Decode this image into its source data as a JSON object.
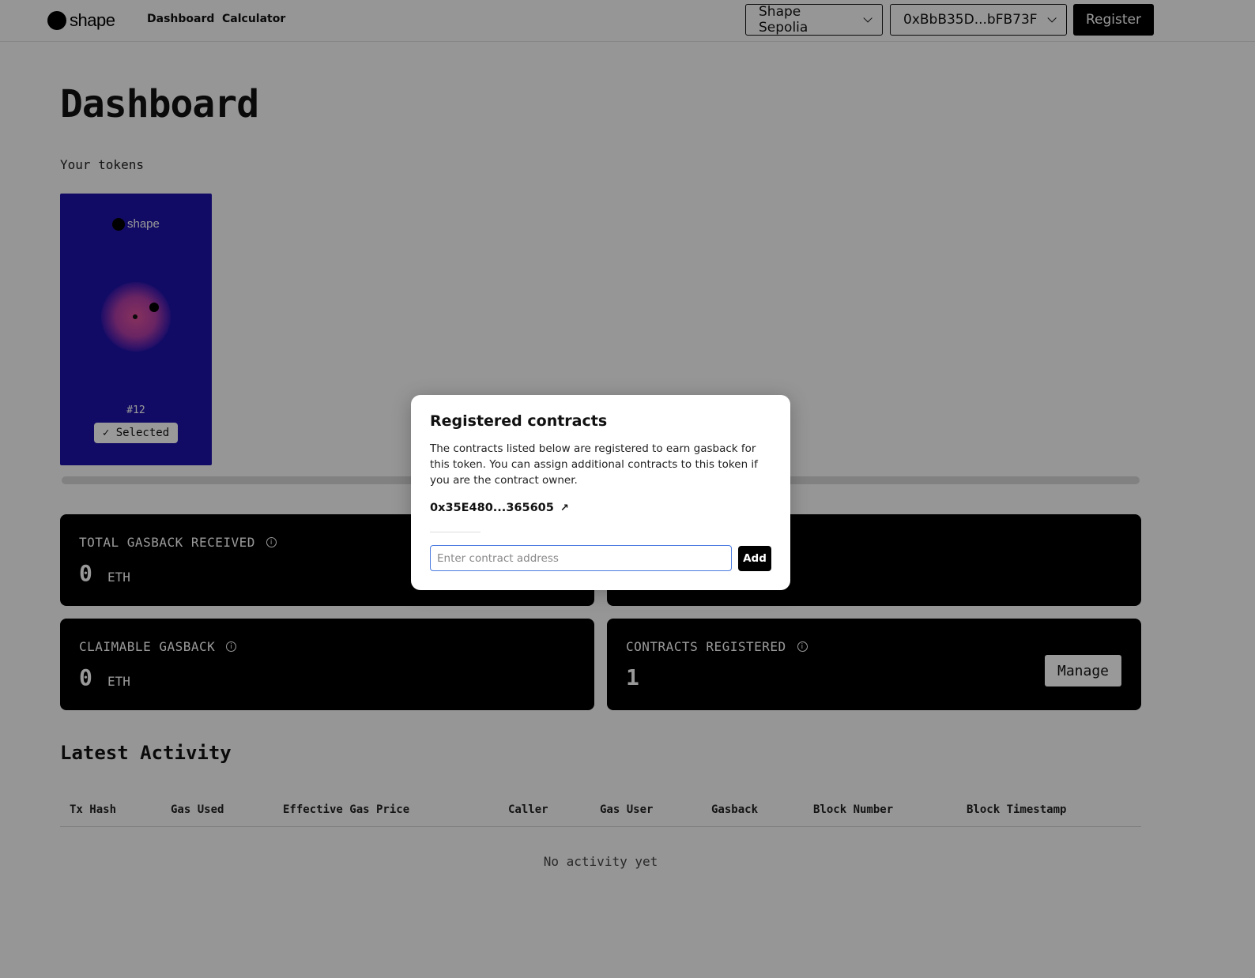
{
  "nav": {
    "logo_text": "shape",
    "links": [
      "Dashboard",
      "Calculator"
    ],
    "network": "Shape Sepolia",
    "wallet": "0xBbB35D...bFB73F",
    "register_label": "Register"
  },
  "page": {
    "title": "Dashboard",
    "tokens_label": "Your tokens"
  },
  "token": {
    "logo_text": "shape",
    "id": "#12",
    "selected_label": "✓ Selected"
  },
  "stats": {
    "total_label": "TOTAL GASBACK RECEIVED",
    "total_value": "0",
    "total_unit": "ETH",
    "claimable_label": "CLAIMABLE GASBACK",
    "claimable_value": "0",
    "claimable_unit": "ETH",
    "contracts_label": "CONTRACTS REGISTERED",
    "contracts_value": "1",
    "manage_label": "Manage"
  },
  "activity": {
    "title": "Latest Activity",
    "columns": [
      "Tx Hash",
      "Gas Used",
      "Effective Gas Price",
      "Caller",
      "Gas User",
      "Gasback",
      "Block Number",
      "Block Timestamp"
    ],
    "empty_text": "No activity yet"
  },
  "modal": {
    "title": "Registered contracts",
    "description": "The contracts listed below are registered to earn gasback for this token. You can assign additional contracts to this token if you are the contract owner.",
    "contract": "0x35E480...365605",
    "input_placeholder": "Enter contract address",
    "input_value": "",
    "add_label": "Add"
  },
  "colors": {
    "token_bg": "#1e13a8",
    "card_bg": "#000000",
    "input_focus": "#4a7be0"
  }
}
